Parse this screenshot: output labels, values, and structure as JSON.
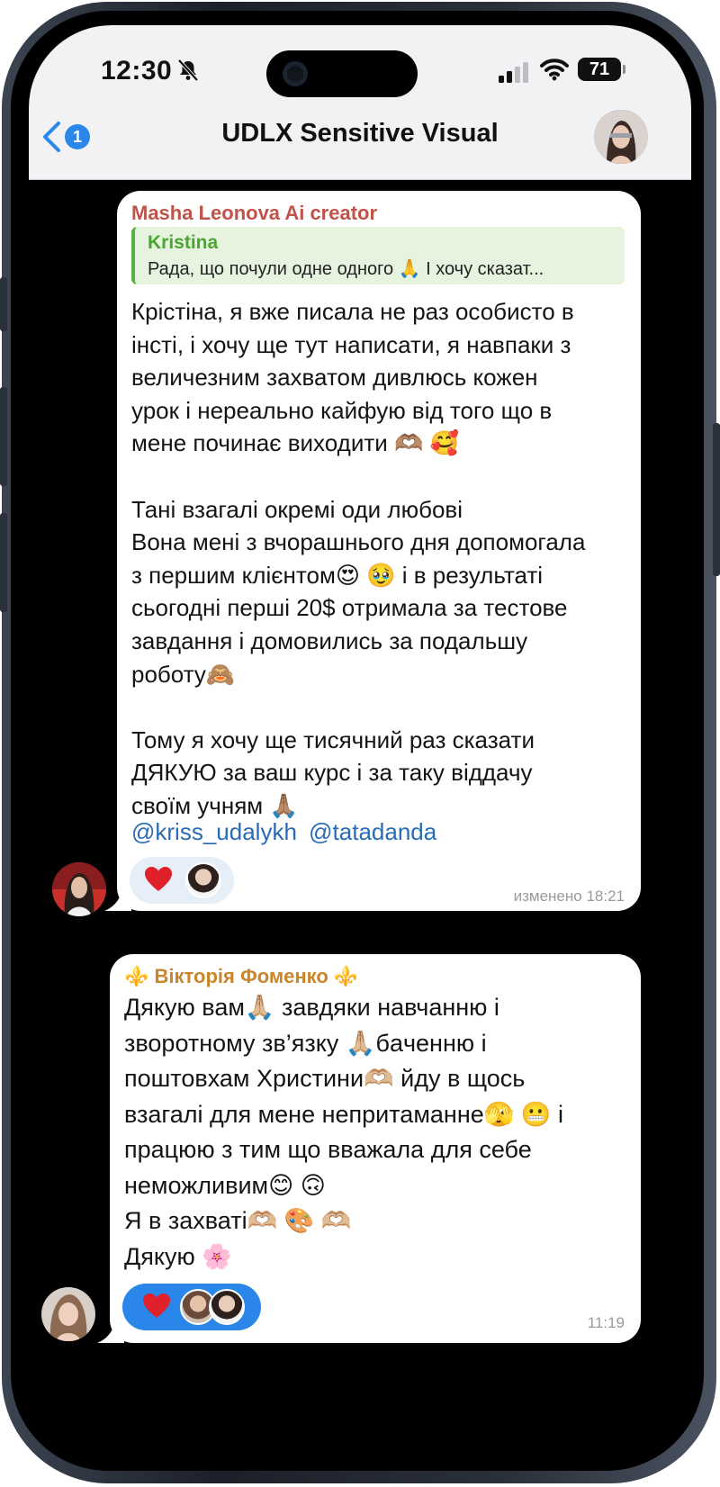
{
  "status_bar": {
    "time": "12:30",
    "battery": "71"
  },
  "header": {
    "back_count": "1",
    "title": "UDLX Sensitive Visual"
  },
  "colors": {
    "accent": "#2a86e8",
    "sender1": "#c0524a",
    "sender2": "#c9862a",
    "reply_accent": "#4aa531",
    "heart": "#e0202a"
  },
  "messages": [
    {
      "sender": "Masha Leonova Ai creator",
      "reply": {
        "author": "Kristina",
        "text": "Рада, що почули одне одного 🙏 І хочу сказат..."
      },
      "text": "Крістіна, я вже писала не раз особисто в\nінсті, і хочу ще тут написати, я навпаки з\nвеличезним захватом дивлюсь кожен\nурок і нереально кайфую від того що в\nмене починає виходити 🫶🏽 🥰\n\nТані взагалі окремі оди любові\nВона мені з вчорашнього дня допомогала\nз першим клієнтом😍 🥹  і в результаті\nсьогодні перші 20$ отримала за тестове\nзавдання і домовились за подальшу\nроботу🙈\n\nТому я хочу ще тисячний раз сказати\nДЯКУЮ за ваш курс і за таку віддачу\nсвоїм учням 🙏🏽",
      "mentions": [
        "@kriss_udalykh",
        "@tatadanda"
      ],
      "reaction": "heart",
      "timestamp": "изменено 18:21"
    },
    {
      "sender": "⚜️ Вікторія Фоменко ⚜️",
      "text": "Дякую вам🙏🏼 завдяки навчанню і\nзворотному зв’язку 🙏🏼бaченню і\nпоштовхам Христини🫶🏼  йду в щось\nвзагалі для мене непритаманне🫣 😬  і\nпрацюю з тим що вважала для себе\nнеможливим😊 🙃\nЯ в захваті🫶🏼 🎨 🫶🏼\nДякую 🌸",
      "reaction": "heart",
      "timestamp": "11:19"
    }
  ]
}
